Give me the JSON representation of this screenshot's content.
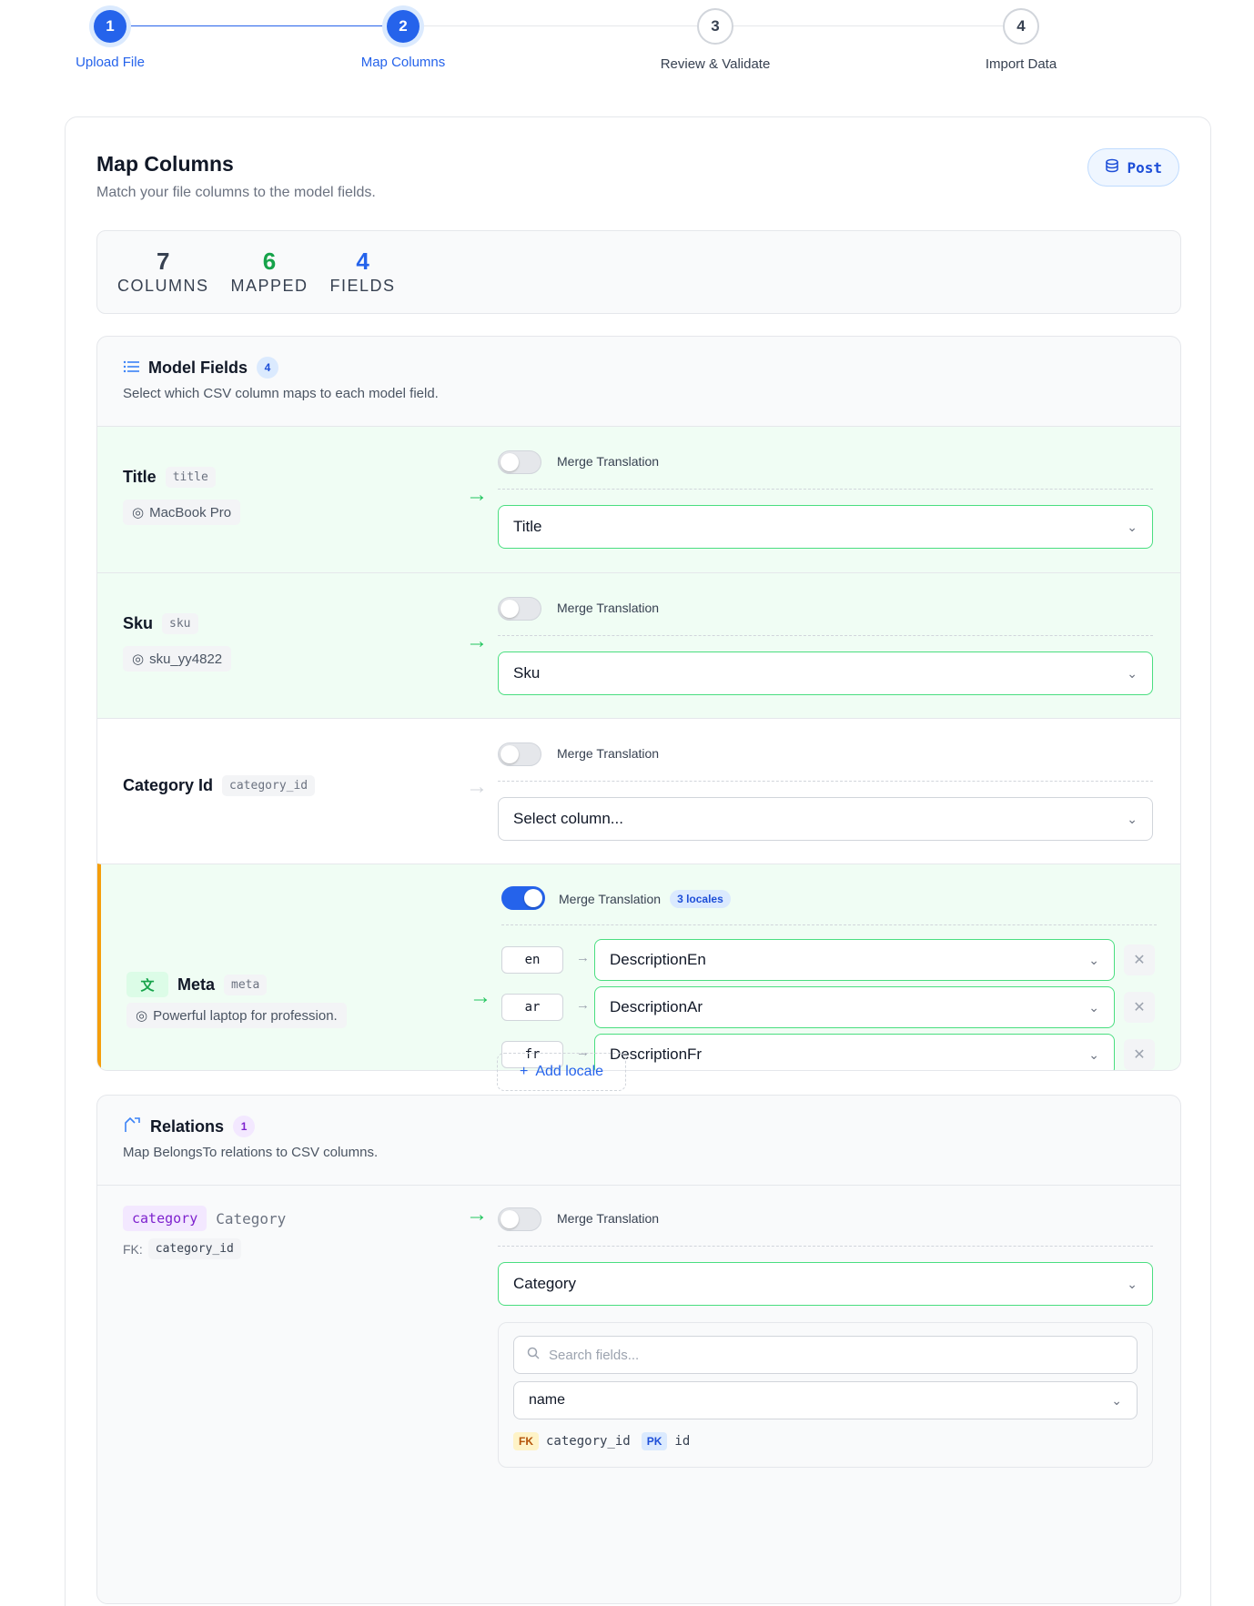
{
  "steps": [
    {
      "number": "1",
      "label": "Upload File",
      "state": "active"
    },
    {
      "number": "2",
      "label": "Map Columns",
      "state": "active"
    },
    {
      "number": "3",
      "label": "Review & Validate",
      "state": "pending"
    },
    {
      "number": "4",
      "label": "Import Data",
      "state": "pending"
    }
  ],
  "header": {
    "title": "Map Columns",
    "subtitle": "Match your file columns to the model fields.",
    "model_button": "Post",
    "model_icon": "database-icon"
  },
  "stats": [
    {
      "value": "7",
      "label": "COLUMNS",
      "color": "#374151"
    },
    {
      "value": "6",
      "label": "MAPPED",
      "color": "#16a34a"
    },
    {
      "value": "4",
      "label": "FIELDS",
      "color": "#2563eb"
    }
  ],
  "model_fields": {
    "title": "Model Fields",
    "count": "4",
    "subtitle": "Select which CSV column maps to each model field.",
    "merge_label": "Merge Translation",
    "rows": [
      {
        "name": "Title",
        "key": "title",
        "preview": "MacBook Pro",
        "selected": "Title",
        "mapped": true
      },
      {
        "name": "Sku",
        "key": "sku",
        "preview": "sku_yy4822",
        "selected": "Sku",
        "mapped": true
      },
      {
        "name": "Category Id",
        "key": "category_id",
        "preview": "",
        "selected": "Select column...",
        "mapped": false
      },
      {
        "name": "Meta",
        "key": "meta",
        "preview": "Powerful laptop for profession.",
        "translatable": true,
        "merge_on": true,
        "locale_count": "3 locales",
        "locales": [
          {
            "code": "en",
            "column": "DescriptionEn"
          },
          {
            "code": "ar",
            "column": "DescriptionAr"
          },
          {
            "code": "fr",
            "column": "DescriptionFr"
          }
        ],
        "add_locale": "Add locale"
      }
    ]
  },
  "relations": {
    "title": "Relations",
    "count": "1",
    "subtitle": "Map BelongsTo relations to CSV columns.",
    "items": [
      {
        "name": "category",
        "model": "Category",
        "fk_label": "FK:",
        "fk": "category_id",
        "merge_label": "Merge Translation",
        "selected": "Category",
        "search_placeholder": "Search fields...",
        "field": "name",
        "fk_badge": "FK",
        "fk_value": "category_id",
        "pk_badge": "PK",
        "pk_value": "id"
      }
    ]
  },
  "colors": {
    "accent": "#2563eb",
    "mapped_bg": "#f0fdf4",
    "mapped_border": "#4ade80",
    "translation_accent": "#f59e0b",
    "relation_accent": "#7e22ce"
  }
}
